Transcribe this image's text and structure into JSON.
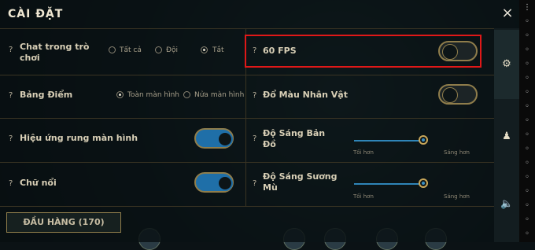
{
  "dialog": {
    "title": "CÀI ĐẶT",
    "close_icon": "×"
  },
  "help_mark": "?",
  "settings": {
    "chat": {
      "label_line1": "Chat trong trò",
      "label_line2": "chơi",
      "options": [
        "Tất cả",
        "Đội",
        "Tắt"
      ],
      "selected": "Tắt"
    },
    "fps60": {
      "label": "60 FPS",
      "on": false
    },
    "scoreboard": {
      "label": "Bảng Điểm",
      "options": [
        "Toàn màn hình",
        "Nửa màn hình"
      ],
      "selected": "Toàn màn hình"
    },
    "char_color": {
      "label": "Đổ Màu Nhân Vật",
      "on": false
    },
    "shake": {
      "label": "Hiệu ứng rung màn hình",
      "on": true
    },
    "brightness_map": {
      "label_line1": "Độ Sáng Bản",
      "label_line2": "Đồ",
      "min_label": "Tối hơn",
      "max_label": "Sáng hơn",
      "level": 0.95
    },
    "floating_text": {
      "label": "Chữ nổi",
      "on": true
    },
    "fog_brightness": {
      "label_line1": "Độ Sáng Sương",
      "label_line2": "Mù",
      "min_label": "Tối hơn",
      "max_label": "Sáng hơn",
      "level": 0.95
    }
  },
  "surrender": {
    "label": "ĐẦU HÀNG (170)"
  },
  "sidebar_icons": [
    "gear-icon",
    "person-icon",
    "speaker-icon"
  ],
  "accent_colors": {
    "highlight": "#e01818",
    "toggle_on": "#1f6fa8",
    "gold": "#8f7d4b"
  }
}
